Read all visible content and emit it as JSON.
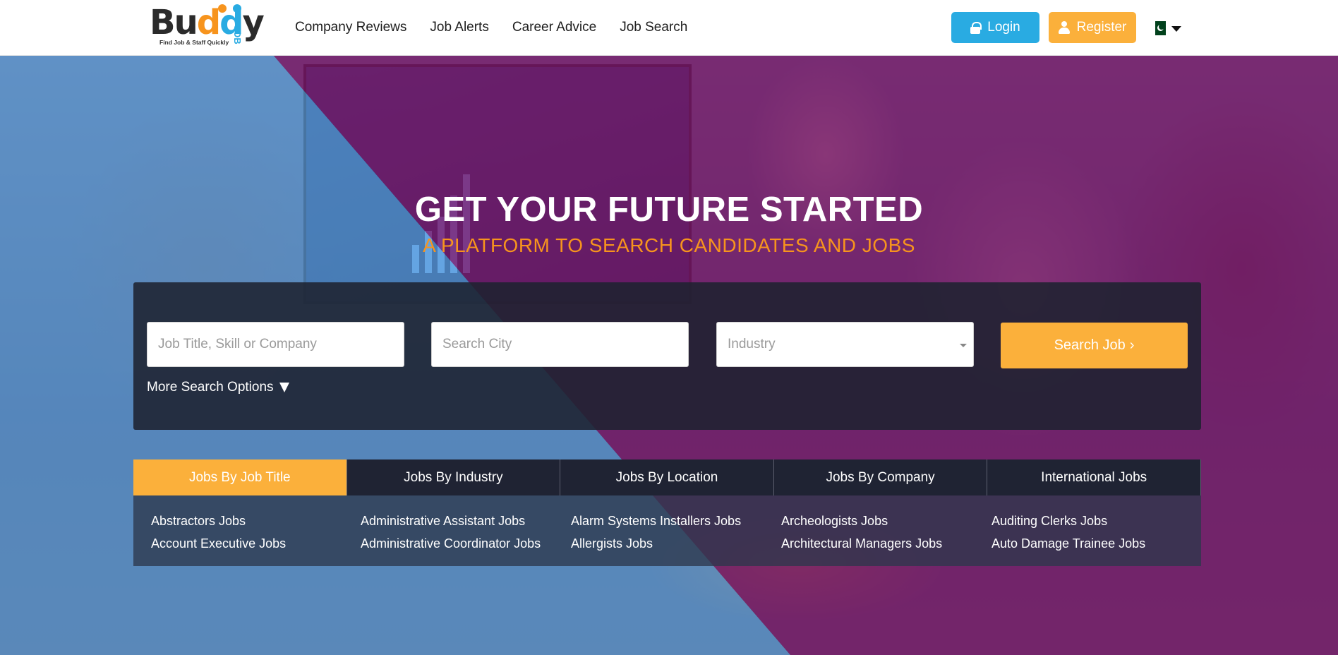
{
  "header": {
    "logo": {
      "brand": "Buddy",
      "badge": "JOB",
      "tagline": "Find Job & Staff Quickly"
    },
    "nav": [
      "Company Reviews",
      "Job Alerts",
      "Career Advice",
      "Job Search"
    ],
    "login_label": "Login",
    "register_label": "Register",
    "country_flag": "Pakistan"
  },
  "hero": {
    "title": "GET YOUR FUTURE STARTED",
    "subtitle": "A PLATFORM TO SEARCH CANDIDATES AND JOBS"
  },
  "search": {
    "keyword_placeholder": "Job Title, Skill or Company",
    "city_placeholder": "Search City",
    "industry_selected": "Industry",
    "button_label": "Search Job",
    "more_options_label": "More Search Options"
  },
  "tabs": [
    {
      "label": "Jobs By Job Title",
      "active": true
    },
    {
      "label": "Jobs By Industry",
      "active": false
    },
    {
      "label": "Jobs By Location",
      "active": false
    },
    {
      "label": "Jobs By Company",
      "active": false
    },
    {
      "label": "International Jobs",
      "active": false
    }
  ],
  "job_links": [
    [
      "Abstractors Jobs",
      "Account Executive Jobs"
    ],
    [
      "Administrative Assistant Jobs",
      "Administrative Coordinator Jobs"
    ],
    [
      "Alarm Systems Installers Jobs",
      "Allergists Jobs"
    ],
    [
      "Archeologists Jobs",
      "Architectural Managers Jobs"
    ],
    [
      "Auditing Clerks Jobs",
      "Auto Damage Trainee Jobs"
    ]
  ],
  "colors": {
    "accent_orange": "#fbb03b",
    "accent_blue": "#29abe2",
    "subtitle_orange": "#f7941d"
  }
}
